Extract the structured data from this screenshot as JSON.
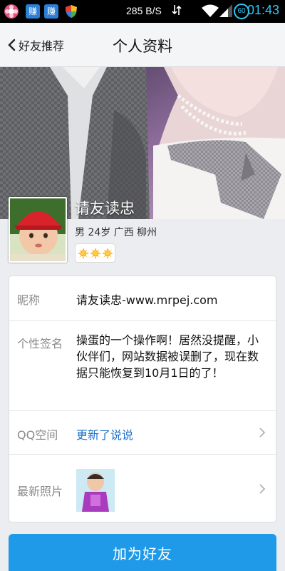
{
  "statusbar": {
    "speed": "285 B/S",
    "battery": "60",
    "time": "01:43",
    "app_icon_left": "赚",
    "app_icon_right": "赚"
  },
  "navbar": {
    "back_label": "好友推荐",
    "title": "个人资料"
  },
  "profile": {
    "name": "请友读忠",
    "info": "男 24岁 广西 柳州"
  },
  "details": {
    "nickname_label": "昵称",
    "nickname_value": "请友读忠-www.mrpej.com",
    "signature_label": "个性签名",
    "signature_value": "操蛋的一个操作啊！居然没提醒，小伙伴们，网站数据被误删了，现在数据只能恢复到10月1日的了！",
    "qzone_label": "QQ空间",
    "qzone_value": "更新了说说",
    "photos_label": "最新照片"
  },
  "actions": {
    "add_friend": "加为好友"
  }
}
